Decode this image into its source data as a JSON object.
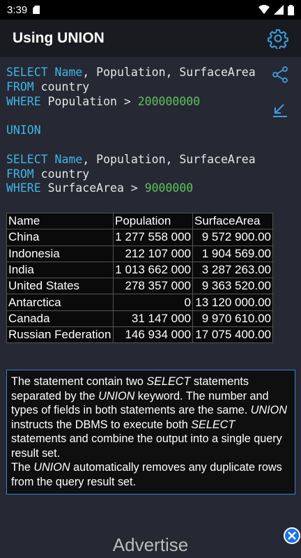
{
  "status_bar": {
    "time": "3:39"
  },
  "app_bar": {
    "title": "Using UNION"
  },
  "code": {
    "line1": {
      "kw": "SELECT",
      "a": "Name",
      "b": ", Population, SurfaceArea"
    },
    "line2": {
      "kw": "FROM",
      "rest": " country"
    },
    "line3": {
      "kw": "WHERE",
      "rest": " Population > ",
      "num": "200000000"
    },
    "line4": {
      "kw": "UNION"
    },
    "line5": {
      "kw": "SELECT",
      "a": "Name",
      "b": ", Population, SurfaceArea"
    },
    "line6": {
      "kw": "FROM",
      "rest": " country"
    },
    "line7": {
      "kw": "WHERE",
      "rest": " SurfaceArea > ",
      "num": "9000000"
    }
  },
  "table": {
    "headers": [
      "Name",
      "Population",
      "SurfaceArea"
    ],
    "rows": [
      [
        "China",
        "1 277 558 000",
        "9 572 900.00"
      ],
      [
        "Indonesia",
        "212 107 000",
        "1 904 569.00"
      ],
      [
        "India",
        "1 013 662 000",
        "3 287 263.00"
      ],
      [
        "United States",
        "278 357 000",
        "9 363 520.00"
      ],
      [
        "Antarctica",
        "0",
        "13 120 000.00"
      ],
      [
        "Canada",
        "31 147 000",
        "9 970 610.00"
      ],
      [
        "Russian Federation",
        "146 934 000",
        "17 075 400.00"
      ]
    ]
  },
  "note": {
    "p1": "The statement contain two ",
    "p1_i": "SELECT",
    "p2": " statements separated by the ",
    "p2_i": "UNION",
    "p3": " keyword. The number and types of fields in both statements are the same. ",
    "p3_i": "UNION",
    "p4": " instructs the DBMS to execute both ",
    "p4_i": "SELECT",
    "p5": " statements and combine the output into a single query result set.",
    "p6": "The ",
    "p6_i": "UNION",
    "p7": " automatically removes any duplicate rows from the query result set."
  },
  "ad": {
    "label": "Advertise"
  },
  "colors": {
    "keyword": "#3fb6e6",
    "number": "#5cc25c",
    "accent": "#3a7fd0"
  },
  "icons": [
    "gear-icon",
    "share-icon",
    "expand-icon",
    "close-icon"
  ]
}
